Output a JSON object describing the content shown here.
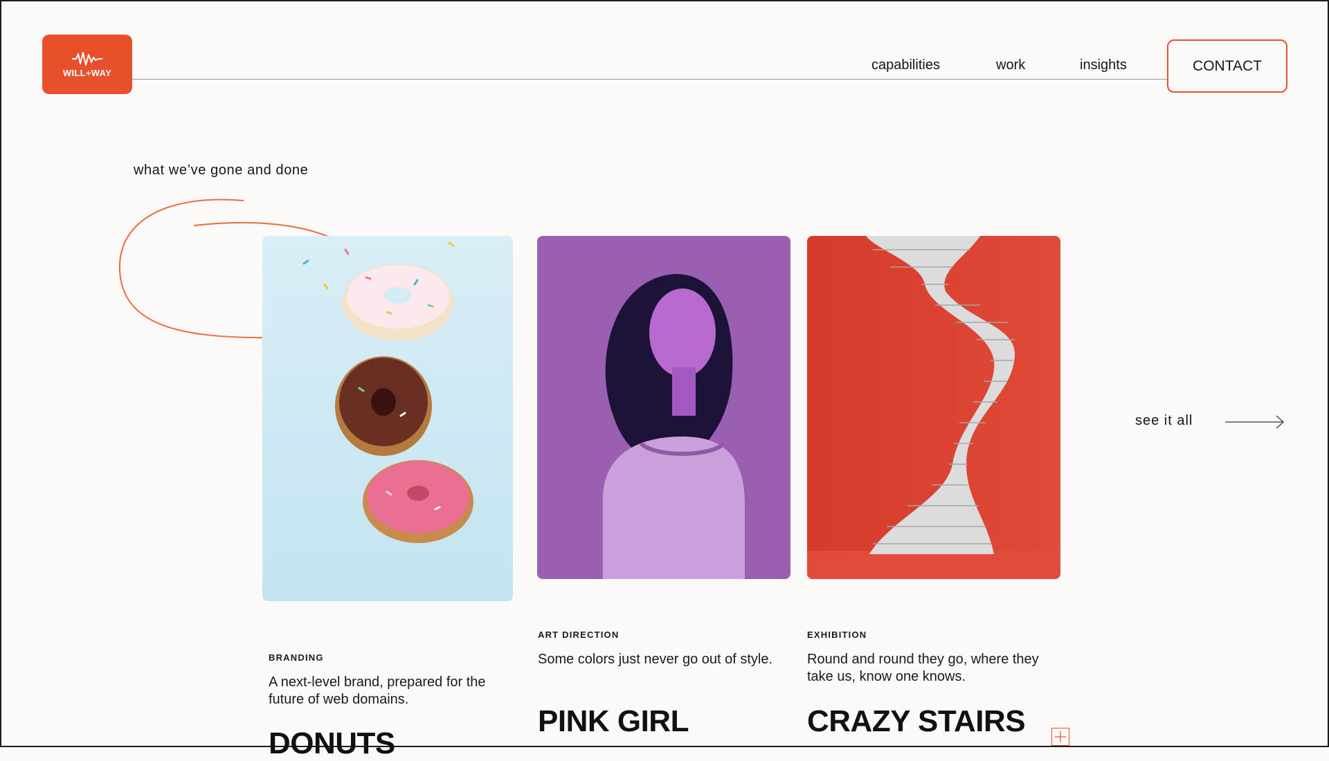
{
  "brand": {
    "logo_text": "WILL+WAY",
    "accent_color": "#e8502b"
  },
  "nav": {
    "links": [
      "capabilities",
      "work",
      "insights"
    ],
    "contact_label": "CONTACT"
  },
  "section": {
    "label": "what we’ve gone and done"
  },
  "projects": [
    {
      "category": "BRANDING",
      "description": "A next-level brand, prepared for the future of web domains.",
      "title": "DONUTS",
      "image": "stacked-donuts-photo"
    },
    {
      "category": "ART DIRECTION",
      "description": "Some colors just never go out of style.",
      "title": "PINK GIRL",
      "image": "woman-purple-portrait-photo"
    },
    {
      "category": "EXHIBITION",
      "description": "Round and round they go, where they take us, know one knows.",
      "title": "CRAZY STAIRS",
      "image": "spiral-stairs-red-photo"
    }
  ],
  "see_all": {
    "label": "see it all",
    "icon": "arrow-right-icon"
  },
  "icons": {
    "expand": "plus-icon"
  }
}
